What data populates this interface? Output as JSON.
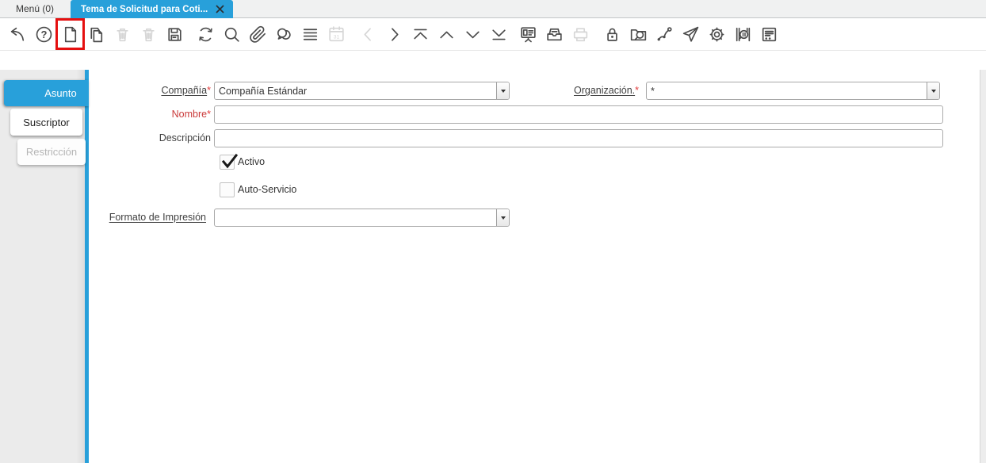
{
  "tabbar": {
    "menu_tab": "Menú (0)",
    "active_tab": "Tema de Solicitud para Coti..."
  },
  "toolbar": {
    "icons": [
      {
        "name": "undo-icon",
        "disabled": false
      },
      {
        "name": "help-icon",
        "disabled": false
      },
      {
        "name": "new-record-icon",
        "disabled": false,
        "highlighted": true
      },
      {
        "name": "copy-record-icon",
        "disabled": false
      },
      {
        "name": "delete-record-icon",
        "disabled": true
      },
      {
        "name": "delete-selection-icon",
        "disabled": true
      },
      {
        "name": "save-icon",
        "disabled": false
      },
      {
        "name": "refresh-icon",
        "disabled": false
      },
      {
        "name": "find-icon",
        "disabled": false
      },
      {
        "name": "attachment-icon",
        "disabled": false
      },
      {
        "name": "chat-icon",
        "disabled": false
      },
      {
        "name": "grid-toggle-icon",
        "disabled": false
      },
      {
        "name": "calendar-icon",
        "disabled": true
      },
      {
        "name": "parent-record-icon",
        "disabled": true
      },
      {
        "name": "detail-record-icon",
        "disabled": false
      },
      {
        "name": "first-record-icon",
        "disabled": false
      },
      {
        "name": "previous-record-icon",
        "disabled": false
      },
      {
        "name": "next-record-icon",
        "disabled": false
      },
      {
        "name": "last-record-icon",
        "disabled": false
      },
      {
        "name": "report-icon",
        "disabled": false
      },
      {
        "name": "archive-icon",
        "disabled": false
      },
      {
        "name": "print-icon",
        "disabled": true
      },
      {
        "name": "lock-icon",
        "disabled": false
      },
      {
        "name": "zoom-across-icon",
        "disabled": false
      },
      {
        "name": "workflow-icon",
        "disabled": false
      },
      {
        "name": "share-icon",
        "disabled": false
      },
      {
        "name": "process-icon",
        "disabled": false
      },
      {
        "name": "product-info-icon",
        "disabled": false
      },
      {
        "name": "quick-form-icon",
        "disabled": false
      }
    ]
  },
  "sidebar": {
    "tabs": [
      {
        "label": "Asunto",
        "state": "active"
      },
      {
        "label": "Suscriptor",
        "state": "normal"
      },
      {
        "label": "Restricción",
        "state": "disabled"
      }
    ]
  },
  "form": {
    "required_marker": "*",
    "compania": {
      "label": "Compañía",
      "value": "Compañía Estándar",
      "required": true
    },
    "organizacion": {
      "label": "Organización.",
      "value": "*",
      "required": true
    },
    "nombre": {
      "label": "Nombre",
      "value": "",
      "required": true
    },
    "descripcion": {
      "label": "Descripción",
      "value": ""
    },
    "activo": {
      "label": "Activo",
      "checked": true
    },
    "auto_servicio": {
      "label": "Auto-Servicio",
      "checked": false
    },
    "formato_impresion": {
      "label": "Formato de Impresión",
      "value": ""
    }
  },
  "colors": {
    "accent": "#28a0da",
    "required_red": "#ca3b3b",
    "highlight_red": "#e50f0f"
  }
}
